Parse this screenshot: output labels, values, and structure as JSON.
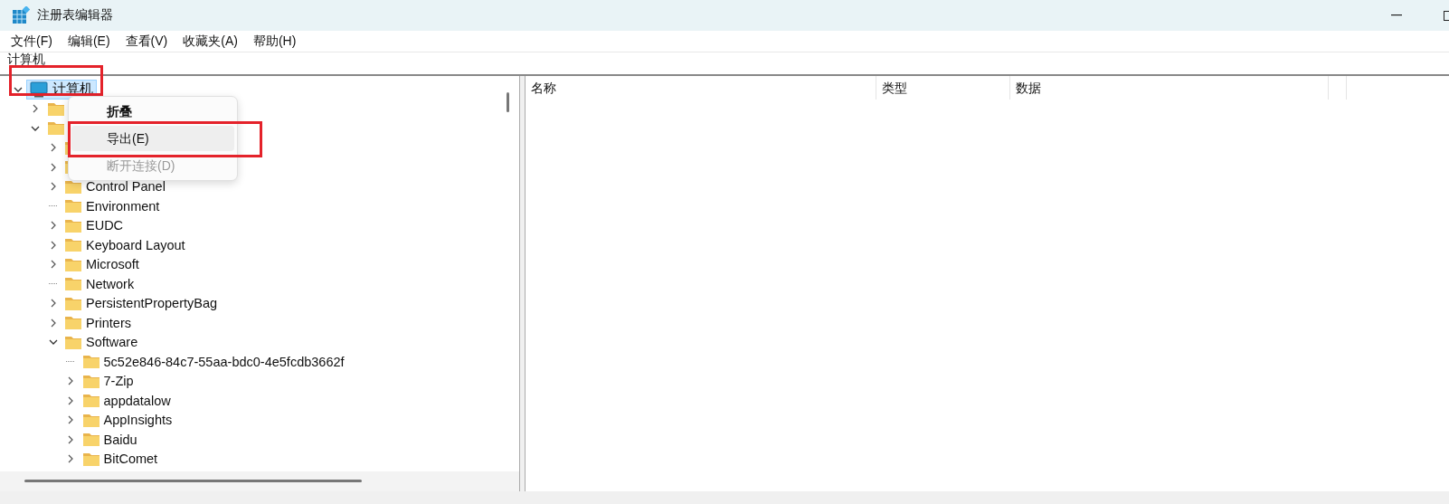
{
  "window": {
    "title": "注册表编辑器"
  },
  "menu_bar": [
    "文件(F)",
    "编辑(E)",
    "查看(V)",
    "收藏夹(A)",
    "帮助(H)"
  ],
  "address_bar": {
    "value": "计算机"
  },
  "tree": {
    "label": "计算机",
    "has_children": true,
    "expanded": true,
    "selected": true,
    "boxed": true,
    "children": [
      {
        "has_children": true,
        "expanded": false,
        "selected": false
      },
      {
        "has_children": true,
        "expanded": true,
        "selected": false,
        "children": [
          {
            "has_children": true,
            "expanded": false,
            "selected": false
          },
          {
            "has_children": true,
            "expanded": false,
            "selected": false
          },
          {
            "label": "Control Panel",
            "has_children": true,
            "expanded": false,
            "selected": false
          },
          {
            "label": "Environment",
            "has_children": false,
            "selected": false
          },
          {
            "label": "EUDC",
            "has_children": true,
            "expanded": false,
            "selected": false
          },
          {
            "label": "Keyboard Layout",
            "has_children": true,
            "expanded": false,
            "selected": false
          },
          {
            "label": "Microsoft",
            "has_children": true,
            "expanded": false,
            "selected": false
          },
          {
            "label": "Network",
            "has_children": false,
            "selected": false
          },
          {
            "label": "PersistentPropertyBag",
            "has_children": true,
            "expanded": false,
            "selected": false
          },
          {
            "label": "Printers",
            "has_children": true,
            "expanded": false,
            "selected": false
          },
          {
            "label": "Software",
            "has_children": true,
            "expanded": true,
            "selected": false,
            "children": [
              {
                "label": "5c52e846-84c7-55aa-bdc0-4e5fcdb3662f",
                "has_children": false,
                "selected": false
              },
              {
                "label": "7-Zip",
                "has_children": true,
                "expanded": false,
                "selected": false
              },
              {
                "label": "appdatalow",
                "has_children": true,
                "expanded": false,
                "selected": false
              },
              {
                "label": "AppInsights",
                "has_children": true,
                "expanded": false,
                "selected": false
              },
              {
                "label": "Baidu",
                "has_children": true,
                "expanded": false,
                "selected": false
              },
              {
                "label": "BitComet",
                "has_children": true,
                "expanded": false,
                "selected": false
              }
            ]
          }
        ]
      }
    ]
  },
  "context_menu": [
    {
      "label": "折叠",
      "default": true,
      "selected": false,
      "disabled": false,
      "boxed": false
    },
    {
      "label": "导出(E)",
      "default": false,
      "selected": true,
      "disabled": false,
      "boxed": true
    },
    {
      "label": "断开连接(D)",
      "default": false,
      "selected": false,
      "disabled": true,
      "boxed": false
    }
  ],
  "list": {
    "columns": [
      "名称",
      "类型",
      "数据"
    ]
  }
}
